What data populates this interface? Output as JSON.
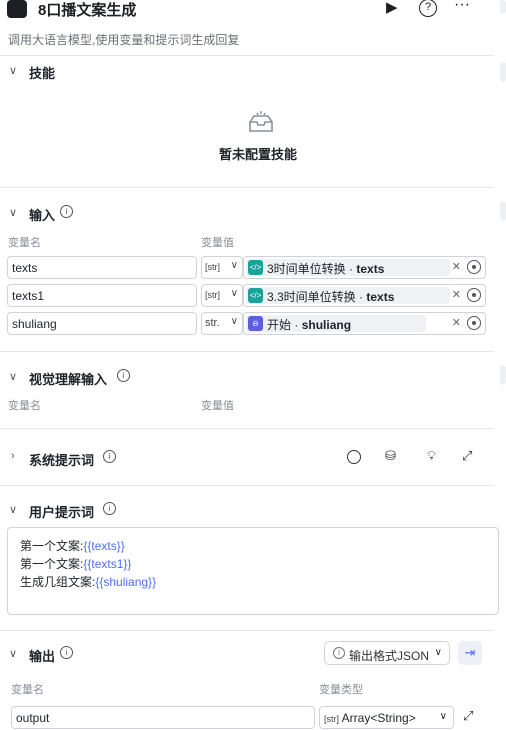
{
  "header": {
    "title": "8口播文案生成",
    "subtitle": "调用大语言模型,使用变量和提示词生成回复"
  },
  "skills": {
    "title": "技能",
    "empty_text": "暂未配置技能"
  },
  "inputs": {
    "title": "输入",
    "col_name": "变量名",
    "col_value": "变量值",
    "rows": [
      {
        "name": "texts",
        "type": "[str]",
        "ref_node": "3时间单位转换",
        "ref_var": "texts",
        "icon": "code-icon",
        "color": "#1aa39a"
      },
      {
        "name": "texts1",
        "type": "[str]",
        "ref_node": "3.3时间单位转换",
        "ref_var": "texts",
        "icon": "code-icon",
        "color": "#1aa39a"
      },
      {
        "name": "shuliang",
        "type": "str.",
        "ref_node": "开始",
        "ref_var": "shuliang",
        "icon": "start-icon",
        "color": "#5b5fe0"
      }
    ]
  },
  "vision": {
    "title": "视觉理解输入",
    "col_name": "变量名",
    "col_value": "变量值"
  },
  "system_prompt": {
    "title": "系统提示词"
  },
  "user_prompt": {
    "title": "用户提示词",
    "lines": [
      {
        "label": "第一个文案:",
        "var": "{{texts}}"
      },
      {
        "label": "第一个文案:",
        "var": "{{texts1}}"
      },
      {
        "label": "生成几组文案:",
        "var": "{{shuliang}}"
      }
    ]
  },
  "output": {
    "title": "输出",
    "format_label": "输出格式JSON",
    "col_name": "变量名",
    "col_type": "变量类型",
    "rows": [
      {
        "name": "output",
        "type_badge": "[str]",
        "type": "Array<String>"
      }
    ]
  }
}
